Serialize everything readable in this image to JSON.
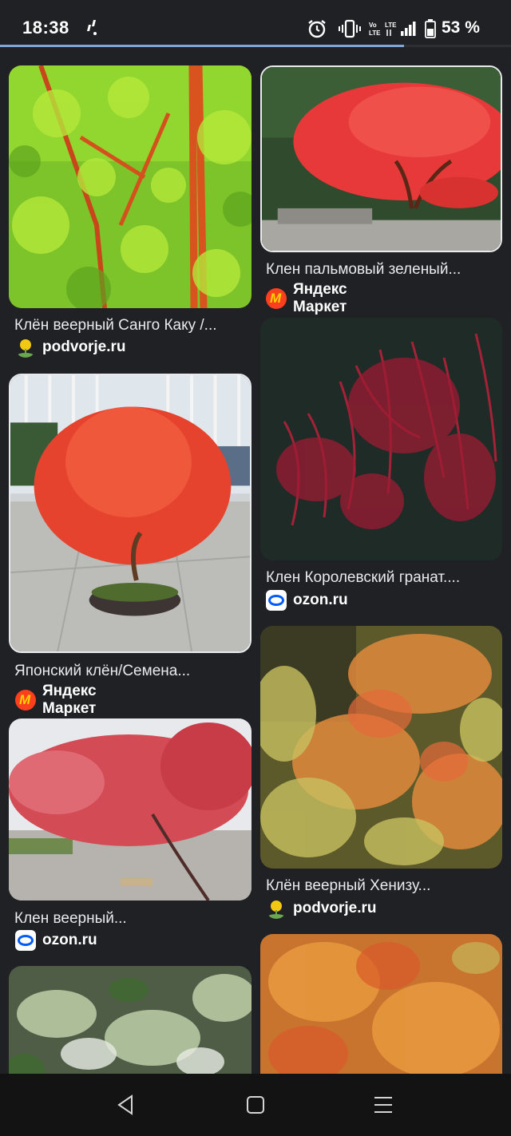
{
  "status_bar": {
    "time": "18:38",
    "battery_percent": "53 %"
  },
  "page_load_progress": 0.79,
  "results": [
    {
      "title": "Клён веерный Санго Каку /...",
      "source": "podvorje.ru",
      "favicon": "podvorje-favicon"
    },
    {
      "title": "Клен пальмовый зеленый...",
      "source": "Яндекс Маркет",
      "favicon": "yandex-market-favicon"
    },
    {
      "title": "Японский клён/Семена...",
      "source": "Яндекс Маркет",
      "favicon": "yandex-market-favicon"
    },
    {
      "title": "Клен Королевский гранат....",
      "source": "ozon.ru",
      "favicon": "ozon-favicon"
    },
    {
      "title": "Клен веерный...",
      "source": "ozon.ru",
      "favicon": "ozon-favicon"
    },
    {
      "title": "Клён веерный Хенизу...",
      "source": "podvorje.ru",
      "favicon": "podvorje-favicon"
    }
  ],
  "colors": {
    "background": "#202124",
    "text": "#e8eaed",
    "navbar": "#131313",
    "ozon_blue": "#005bff",
    "yandex_red": "#fc3f1d"
  },
  "navbar": {
    "back": "back-triangle-icon",
    "home": "home-square-icon",
    "recents": "recents-lines-icon"
  }
}
